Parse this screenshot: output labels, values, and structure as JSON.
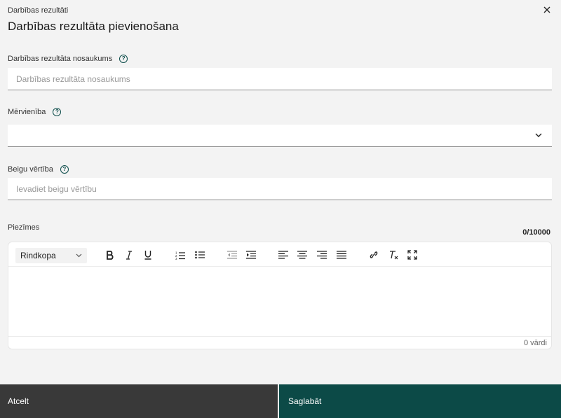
{
  "header": {
    "breadcrumb": "Darbības rezultāti",
    "title": "Darbības rezultāta pievienošana",
    "close_icon": "close-icon"
  },
  "fields": {
    "name": {
      "label": "Darbības rezultāta nosaukums",
      "placeholder": "Darbības rezultāta nosaukums",
      "value": ""
    },
    "unit": {
      "label": "Mērvienība",
      "value": ""
    },
    "end_value": {
      "label": "Beigu vērtība",
      "placeholder": "Ievadiet beigu vērtību",
      "value": ""
    },
    "notes": {
      "label": "Piezīmes",
      "counter": "0/10000",
      "style_select": "Rindkopa",
      "word_count": "0 vārdi"
    }
  },
  "toolbar_icons": [
    "bold-icon",
    "italic-icon",
    "underline-icon",
    "ordered-list-icon",
    "bullet-list-icon",
    "outdent-icon",
    "indent-icon",
    "align-left-icon",
    "align-center-icon",
    "align-right-icon",
    "align-justify-icon",
    "link-icon",
    "clear-format-icon",
    "fullscreen-icon"
  ],
  "actions": {
    "cancel": "Atcelt",
    "save": "Saglabāt"
  },
  "colors": {
    "accent": "#0c4a47",
    "cancel_bg": "#393939",
    "page_bg": "#f3f3f3"
  }
}
